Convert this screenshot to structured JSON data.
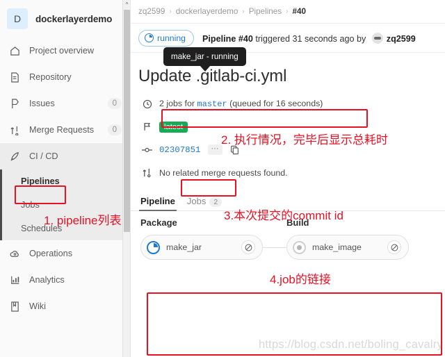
{
  "sidebar": {
    "project": {
      "initial": "D",
      "name": "dockerlayerdemo"
    },
    "items": [
      {
        "icon": "home-icon",
        "label": "Project overview",
        "badge": null
      },
      {
        "icon": "file-icon",
        "label": "Repository",
        "badge": null
      },
      {
        "icon": "issue-icon",
        "label": "Issues",
        "badge": "0"
      },
      {
        "icon": "merge-request-icon",
        "label": "Merge Requests",
        "badge": "0"
      },
      {
        "icon": "rocket-icon",
        "label": "CI / CD",
        "badge": null
      },
      {
        "icon": "cloud-gear-icon",
        "label": "Operations",
        "badge": null
      },
      {
        "icon": "chart-icon",
        "label": "Analytics",
        "badge": null
      },
      {
        "icon": "book-icon",
        "label": "Wiki",
        "badge": null
      }
    ],
    "cicd_subitems": [
      {
        "label": "Pipelines",
        "current": true
      },
      {
        "label": "Jobs",
        "current": false
      },
      {
        "label": "Schedules",
        "current": false
      }
    ]
  },
  "breadcrumb": {
    "items": [
      "zq2599",
      "dockerlayerdemo",
      "Pipelines"
    ],
    "current": "#40",
    "separator": "›"
  },
  "header": {
    "status_label": "running",
    "status_color": "#1f78d1",
    "pipeline_label": "Pipeline #40",
    "triggered_text": " triggered 31 seconds ago by ",
    "user_name": "zq2599"
  },
  "page": {
    "title": "Update .gitlab-ci.yml"
  },
  "info": {
    "jobs_prefix": "2 jobs for ",
    "branch": "master",
    "jobs_suffix": " (queued for 16 seconds)",
    "latest_badge": "latest",
    "commit_sha": "02307851",
    "ellipsis": "···",
    "merge_request_text": "No related merge requests found."
  },
  "tabs": [
    {
      "label": "Pipeline",
      "active": true,
      "count": null
    },
    {
      "label": "Jobs",
      "active": false,
      "count": "2"
    }
  ],
  "pipeline": {
    "stages": [
      {
        "name": "Package",
        "jobs": [
          {
            "name": "make_jar",
            "status": "running",
            "cancel_label": "cancel"
          }
        ]
      },
      {
        "name": "Build",
        "jobs": [
          {
            "name": "make_image",
            "status": "created",
            "cancel_label": "cancel"
          }
        ]
      }
    ],
    "tooltip": "make_jar - running"
  },
  "annotations": {
    "color": "#e81123",
    "notes": [
      {
        "text": "1. pipeline列表"
      },
      {
        "text": "2. 执行情况，完毕后显示总耗时"
      },
      {
        "text": "3.本次提交的commit id"
      },
      {
        "text": "4.job的链接"
      }
    ]
  },
  "watermark": "https://blog.csdn.net/boling_cavalry"
}
